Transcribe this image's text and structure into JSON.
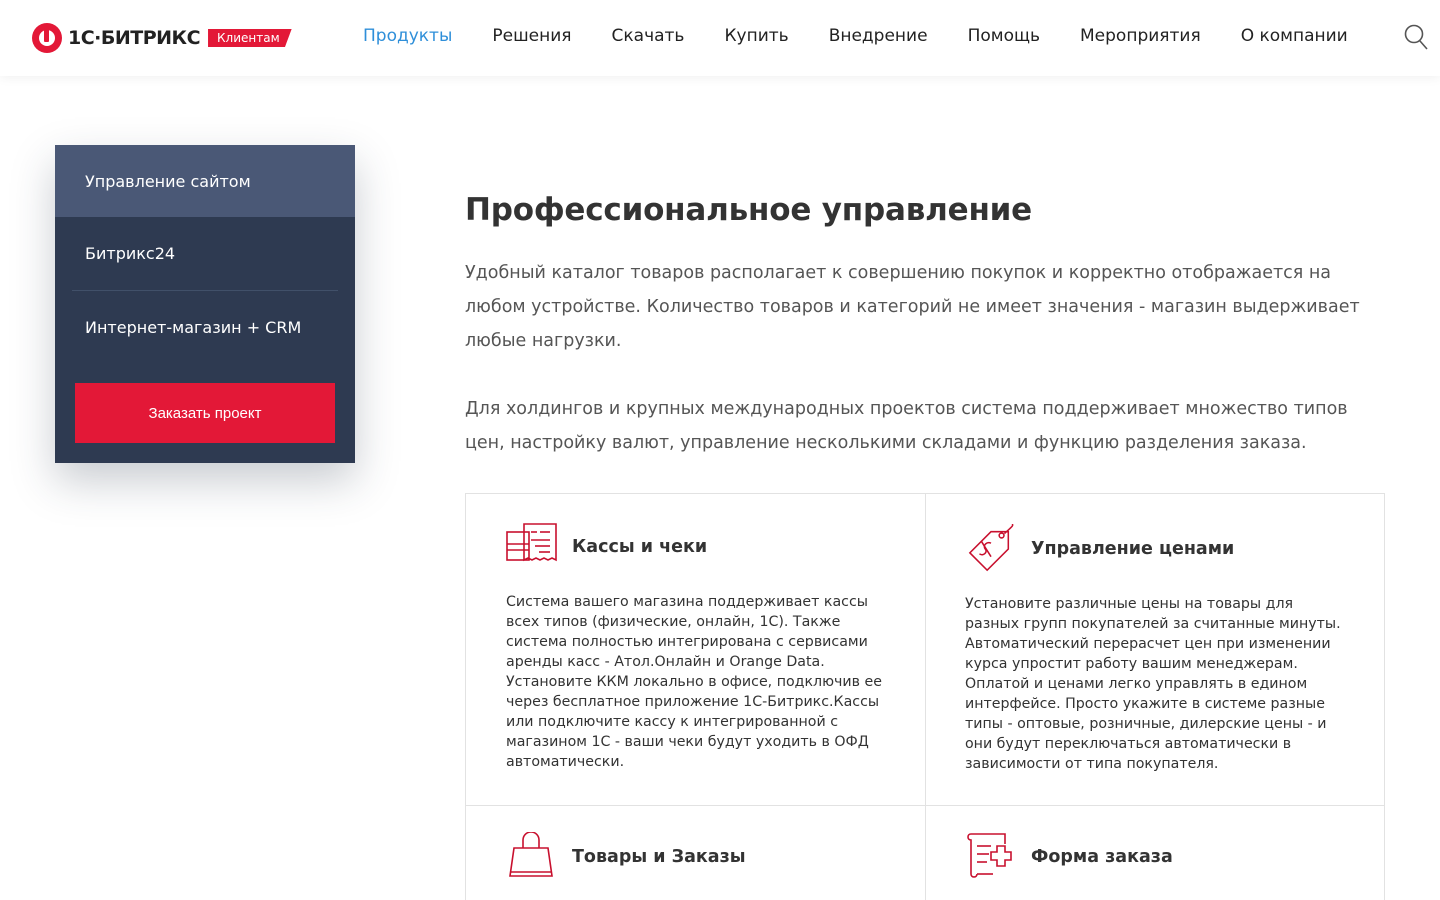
{
  "header": {
    "logo_text": "1С·БИТРИКС",
    "logo_badge": "Клиентам",
    "nav": [
      {
        "label": "Продукты",
        "active": true
      },
      {
        "label": "Решения"
      },
      {
        "label": "Скачать"
      },
      {
        "label": "Купить"
      },
      {
        "label": "Внедрение"
      },
      {
        "label": "Помощь"
      },
      {
        "label": "Мероприятия"
      },
      {
        "label": "О компании"
      }
    ],
    "search_icon": "search-icon"
  },
  "sidebar": {
    "items": [
      {
        "label": "Управление сайтом",
        "active": true
      },
      {
        "label": "Битрикс24"
      },
      {
        "label": "Интернет-магазин + CRM"
      }
    ],
    "order_button": "Заказать проект"
  },
  "main": {
    "title": "Профессиональное управление",
    "paragraph1": "Удобный каталог товаров располагает к совершению покупок и корректно отображается на любом устройстве. Количество товаров и категорий не имеет значения - магазин выдерживает любые нагрузки.",
    "paragraph2": "Для холдингов и крупных международных проектов система поддерживает множество типов цен, настройку валют, управление несколькими складами и функцию разделения заказа."
  },
  "features": [
    {
      "icon": "cash-register-icon",
      "title": "Кассы и чеки",
      "description": "Система вашего магазина поддерживает кассы всех типов (физические, онлайн, 1С). Также система полностью интегрирована с сервисами аренды касс - Атол.Онлайн и Orange Data. Установите ККМ локально в офисе, подключив ее через бесплатное приложение 1С-Битрикс.Кассы или подключите кассу к интегрированной с магазином 1С - ваши чеки будут уходить в ОФД автоматически."
    },
    {
      "icon": "price-tag-icon",
      "title": "Управление ценами",
      "description": "Установите различные цены на товары для разных групп покупателей за считанные минуты. Автоматический перерасчет цен при изменении курса упростит работу вашим менеджерам. Оплатой и ценами легко управлять в едином интерфейсе. Просто укажите в системе разные типы - оптовые, розничные, дилерские цены - и они будут переключаться автоматически в зависимости от типа покупателя."
    },
    {
      "icon": "shopping-bag-icon",
      "title": "Товары и Заказы",
      "description": ""
    },
    {
      "icon": "order-form-icon",
      "title": "Форма заказа",
      "description": ""
    }
  ],
  "colors": {
    "brand_red": "#e31837",
    "nav_active": "#2f8fd9",
    "sidebar_bg": "#2e3a51",
    "sidebar_active": "#4a5876"
  }
}
